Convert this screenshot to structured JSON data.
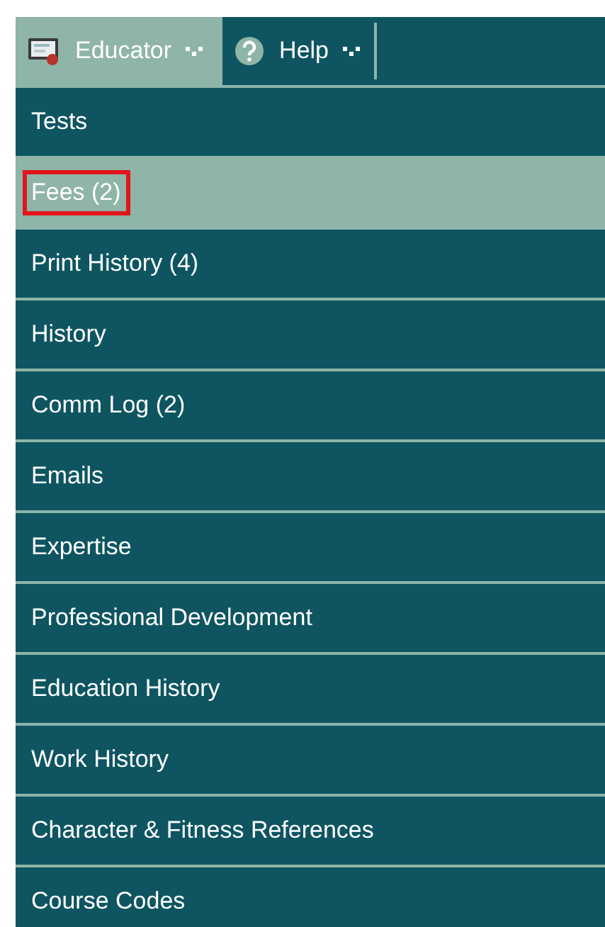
{
  "menu_bar": [
    {
      "label": "Educator",
      "kind": "educator",
      "selected": true
    },
    {
      "label": "Help",
      "kind": "help",
      "selected": false
    }
  ],
  "menu_items": [
    {
      "label": "Tests",
      "selected": false,
      "outlined": false
    },
    {
      "label": "Fees (2)",
      "selected": true,
      "outlined": true
    },
    {
      "label": "Print History (4)",
      "selected": false,
      "outlined": false
    },
    {
      "label": "History",
      "selected": false,
      "outlined": false
    },
    {
      "label": "Comm Log (2)",
      "selected": false,
      "outlined": false
    },
    {
      "label": "Emails",
      "selected": false,
      "outlined": false
    },
    {
      "label": "Expertise",
      "selected": false,
      "outlined": false
    },
    {
      "label": "Professional Development",
      "selected": false,
      "outlined": false
    },
    {
      "label": "Education History",
      "selected": false,
      "outlined": false
    },
    {
      "label": "Work History",
      "selected": false,
      "outlined": false
    },
    {
      "label": "Character & Fitness References",
      "selected": false,
      "outlined": false
    },
    {
      "label": "Course Codes",
      "selected": false,
      "outlined": false
    }
  ]
}
